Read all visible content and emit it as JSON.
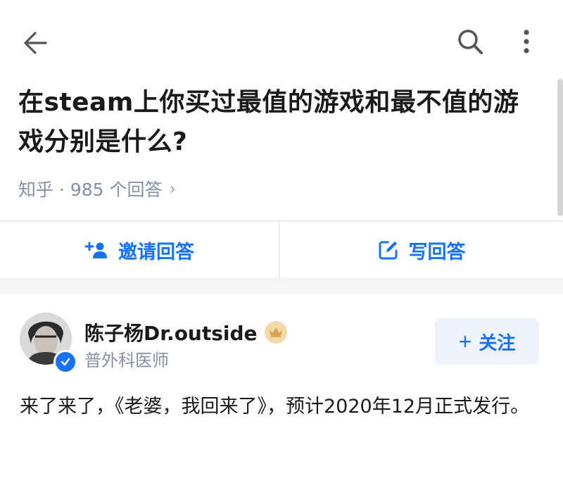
{
  "header": {
    "back_icon": "arrow-left-icon",
    "search_icon": "search-icon",
    "more_icon": "more-vertical-icon"
  },
  "question": {
    "title": "在steam上你买过最值的游戏和最不值的游戏分别是什么?",
    "meta": "知乎 · 985 个回答"
  },
  "actions": {
    "invite_label": "邀请回答",
    "write_label": "写回答"
  },
  "answer": {
    "author": "陈子杨Dr.outside",
    "role": "普外科医师",
    "follow_label": "关注",
    "content": "来了来了，《老婆，我回来了》，预计2020年12月正式发行。"
  },
  "colors": {
    "accent": "#1772f6",
    "muted": "#8590a6"
  }
}
